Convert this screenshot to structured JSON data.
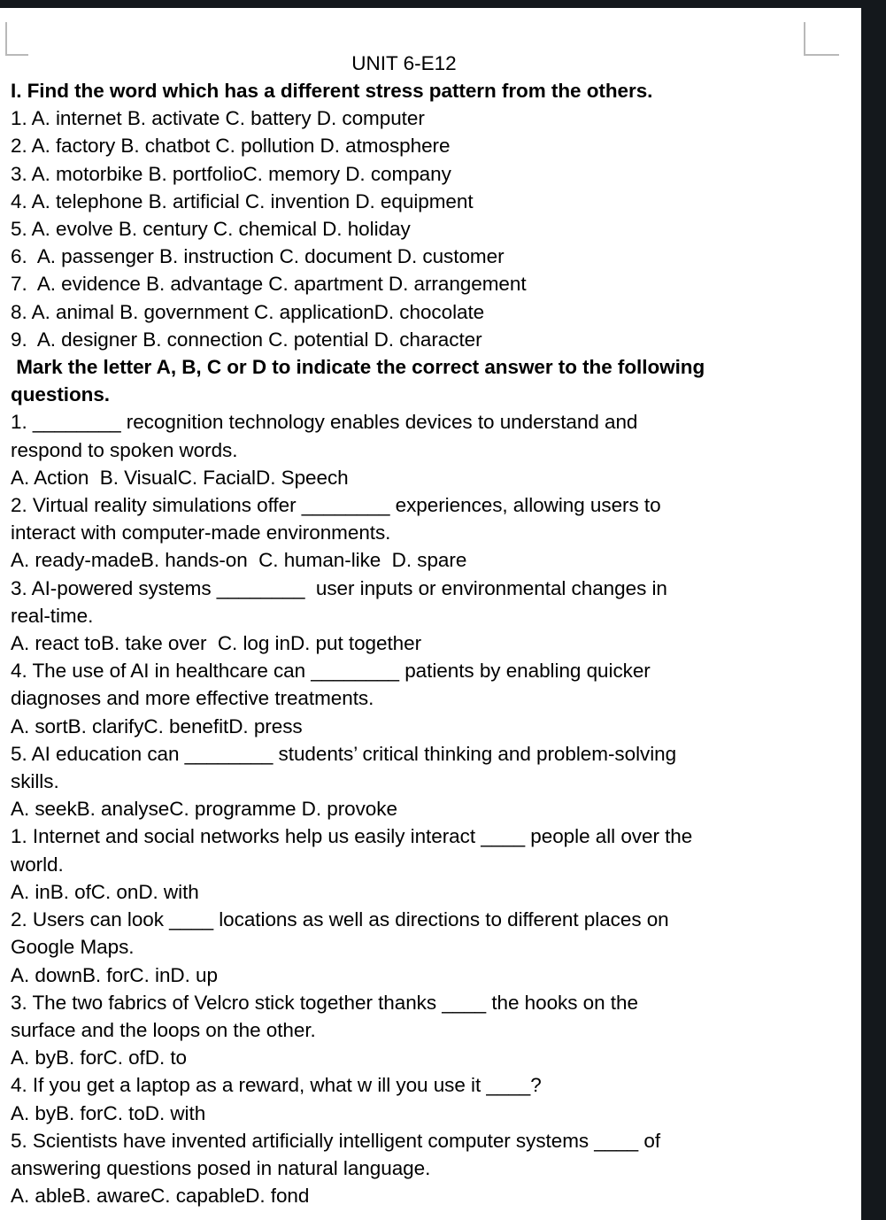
{
  "document": {
    "title": "UNIT 6-E12",
    "section_1_heading": "I. Find the word which has a different stress pattern from the others.",
    "stress_items": [
      "1. A. internet B. activate C. battery D. computer",
      "2. A. factory B. chatbot C. pollution D. atmosphere",
      "3. A. motorbike B. portfolioC. memory D. company",
      "4. A. telephone B. artificial C. invention D. equipment",
      "5. A. evolve B. century C. chemical D. holiday",
      "6.  A. passenger B. instruction C. document D. customer",
      "7.  A. evidence B. advantage C. apartment D. arrangement",
      "8. A. animal B. government C. applicationD. chocolate",
      "9.  A. designer B. connection C. potential D. character"
    ],
    "section_2_heading_line_1": " Mark the letter A, B, C or D to indicate the correct answer to the following",
    "section_2_heading_line_2": "questions.",
    "section_2_items": [
      {
        "question_lines": [
          "1. ________ recognition technology enables devices to understand and",
          "respond to spoken words."
        ],
        "options_line": "A. Action  B. VisualC. FacialD. Speech"
      },
      {
        "question_lines": [
          "2. Virtual reality simulations offer ________ experiences, allowing users to",
          "interact with computer-made environments."
        ],
        "options_line": "A. ready-madeB. hands-on  C. human-like  D. spare"
      },
      {
        "question_lines": [
          "3. AI-powered systems ________  user inputs or environmental changes in",
          "real-time."
        ],
        "options_line": "A. react toB. take over  C. log inD. put together"
      },
      {
        "question_lines": [
          "4. The use of AI in healthcare can ________ patients by enabling quicker",
          "diagnoses and more effective treatments."
        ],
        "options_line": "A. sortB. clarifyC. benefitD. press"
      },
      {
        "question_lines": [
          "5. AI education can ________ students’ critical thinking and problem-solving",
          "skills."
        ],
        "options_line": "A. seekB. analyseC. programme D. provoke"
      }
    ],
    "section_3_items": [
      {
        "question_lines": [
          "1. Internet and social networks help us easily interact ____ people all over the",
          "world."
        ],
        "options_line": "A. inB. ofC. onD. with"
      },
      {
        "question_lines": [
          "2. Users can look ____ locations as well as directions to different places on",
          "Google Maps."
        ],
        "options_line": "A. downB. forC. inD. up"
      },
      {
        "question_lines": [
          "3. The two fabrics of Velcro stick together thanks ____ the hooks on the",
          "surface and the loops on the other."
        ],
        "options_line": "A. byB. forC. ofD. to"
      },
      {
        "question_lines": [
          "4. If you get a laptop as a reward, what w ill you use it ____?"
        ],
        "options_line": "A. byB. forC. toD. with"
      },
      {
        "question_lines": [
          "5. Scientists have invented artificially intelligent computer systems ____ of",
          "answering questions posed in natural language."
        ],
        "options_line": "A. ableB. awareC. capableD. fond"
      }
    ]
  },
  "colors": {
    "page_background": "#ffffff",
    "text": "#000000",
    "scan_band": "#14181c",
    "crop_mark": "#b9b9b9"
  }
}
